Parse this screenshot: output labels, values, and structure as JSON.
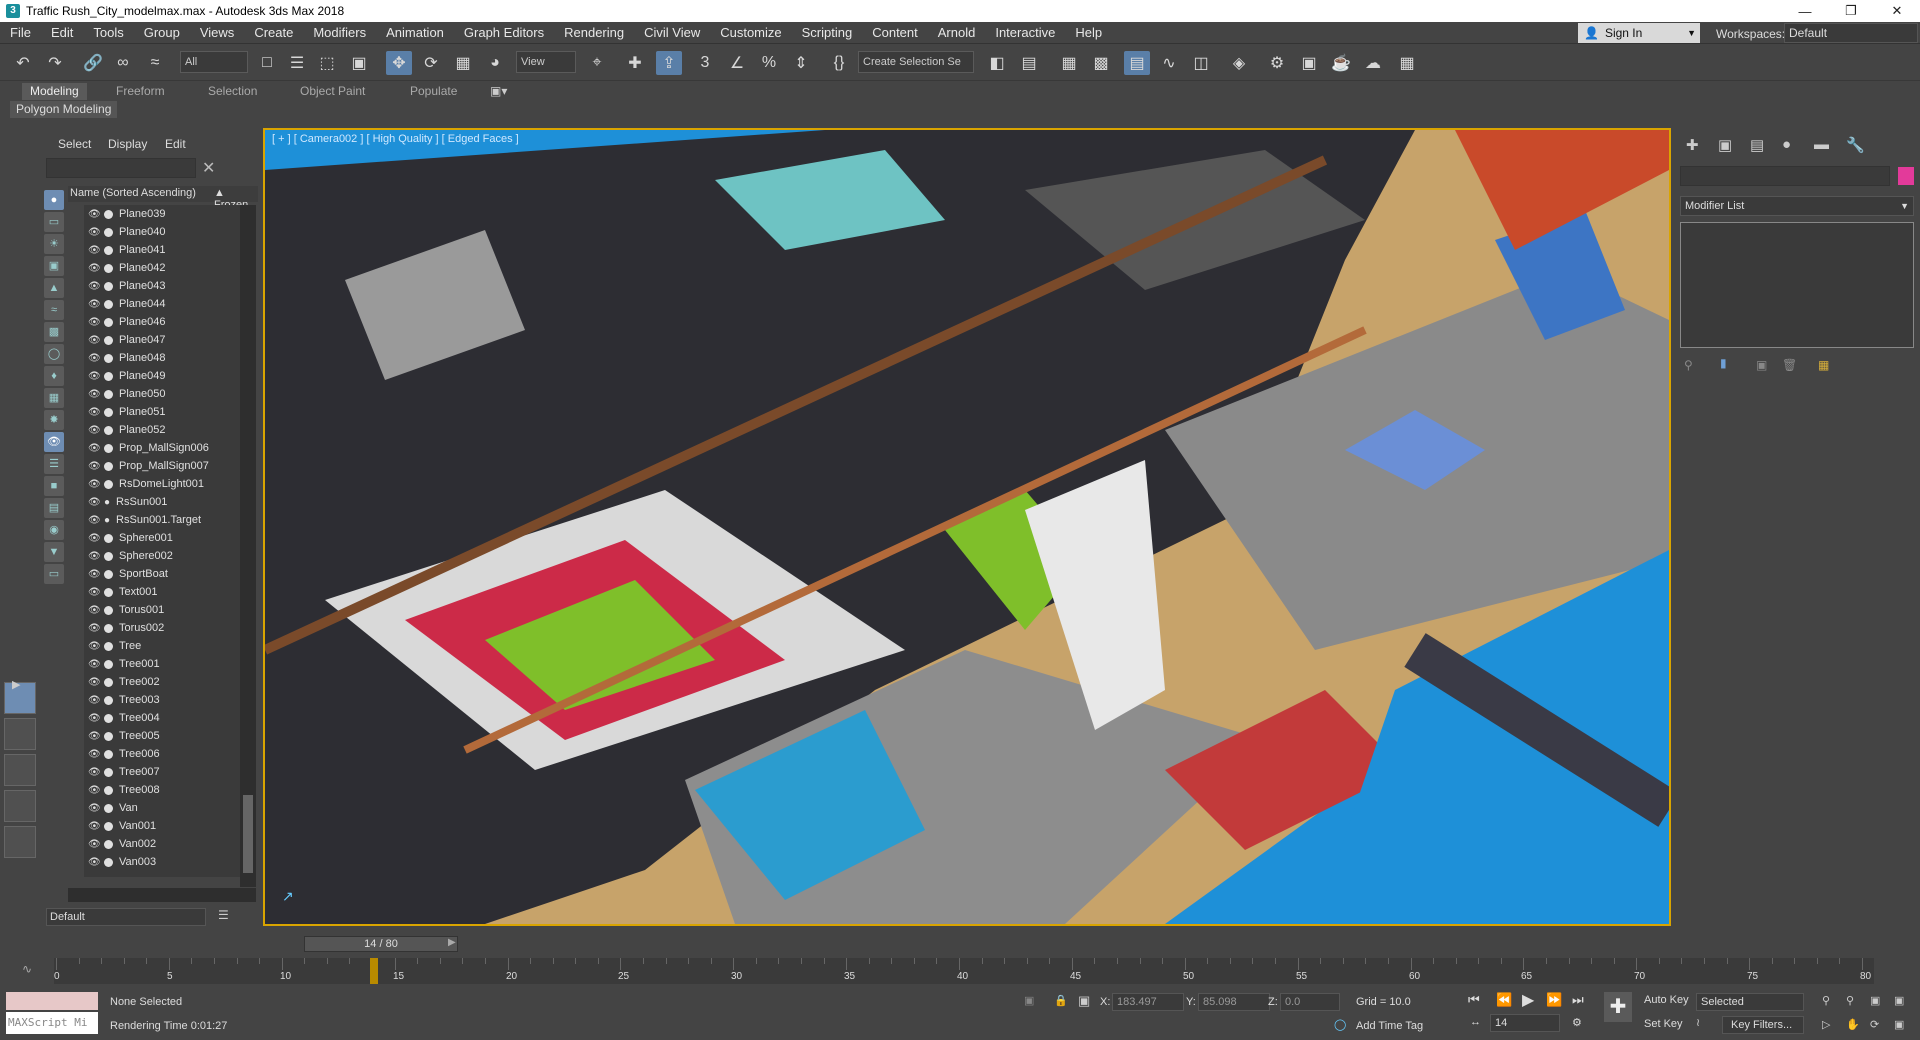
{
  "window": {
    "title": "Traffic Rush_City_modelmax.max - Autodesk 3ds Max 2018",
    "controls": [
      "—",
      "❐",
      "✕"
    ]
  },
  "menu": [
    "File",
    "Edit",
    "Tools",
    "Group",
    "Views",
    "Create",
    "Modifiers",
    "Animation",
    "Graph Editors",
    "Rendering",
    "Civil View",
    "Customize",
    "Scripting",
    "Content",
    "Arnold",
    "Interactive",
    "Help"
  ],
  "account": {
    "signin": "Sign In",
    "workspaces_label": "Workspaces:",
    "workspace": "Default"
  },
  "toolbar": {
    "filter": "All",
    "refcoord": "View",
    "selection_set": "Create Selection Se"
  },
  "ribbon": {
    "tabs": [
      "Modeling",
      "Freeform",
      "Selection",
      "Object Paint",
      "Populate"
    ],
    "panel": "Polygon Modeling"
  },
  "scene_explorer": {
    "tabs": [
      "Select",
      "Display",
      "Edit"
    ],
    "column_name": "Name (Sorted Ascending)",
    "column_frozen": "▲ Frozen",
    "items": [
      "Plane039",
      "Plane040",
      "Plane041",
      "Plane042",
      "Plane043",
      "Plane044",
      "Plane046",
      "Plane047",
      "Plane048",
      "Plane049",
      "Plane050",
      "Plane051",
      "Plane052",
      "Prop_MallSign006",
      "Prop_MallSign007",
      "RsDomeLight001",
      "RsSun001",
      "RsSun001.Target",
      "Sphere001",
      "Sphere002",
      "SportBoat",
      "Text001",
      "Torus001",
      "Torus002",
      "Tree",
      "Tree001",
      "Tree002",
      "Tree003",
      "Tree004",
      "Tree005",
      "Tree006",
      "Tree007",
      "Tree008",
      "Van",
      "Van001",
      "Van002",
      "Van003"
    ],
    "layer": "Default"
  },
  "viewport": {
    "label": "[ + ] [ Camera002 ] [ High Quality ] [ Edged Faces ]"
  },
  "command_panel": {
    "modifier_list": "Modifier List",
    "color": "#e33a9a"
  },
  "timeline": {
    "frame": "14 / 80",
    "ticks": [
      "0",
      "5",
      "10",
      "15",
      "20",
      "25",
      "30",
      "35",
      "40",
      "45",
      "50",
      "55",
      "60",
      "65",
      "70",
      "75",
      "80"
    ],
    "current": 14,
    "end": 80
  },
  "status": {
    "maxscript": "MAXScript Mi",
    "selection": "None Selected",
    "render_time": "Rendering Time  0:01:27",
    "x_label": "X:",
    "x": "183.497",
    "y_label": "Y:",
    "y": "85.098",
    "z_label": "Z:",
    "z": "0.0",
    "grid": "Grid = 10.0",
    "add_time_tag": "Add Time Tag",
    "auto_key": "Auto Key",
    "key_mode": "Selected",
    "set_key": "Set Key",
    "key_filters": "Key Filters...",
    "frame_field": "14"
  }
}
